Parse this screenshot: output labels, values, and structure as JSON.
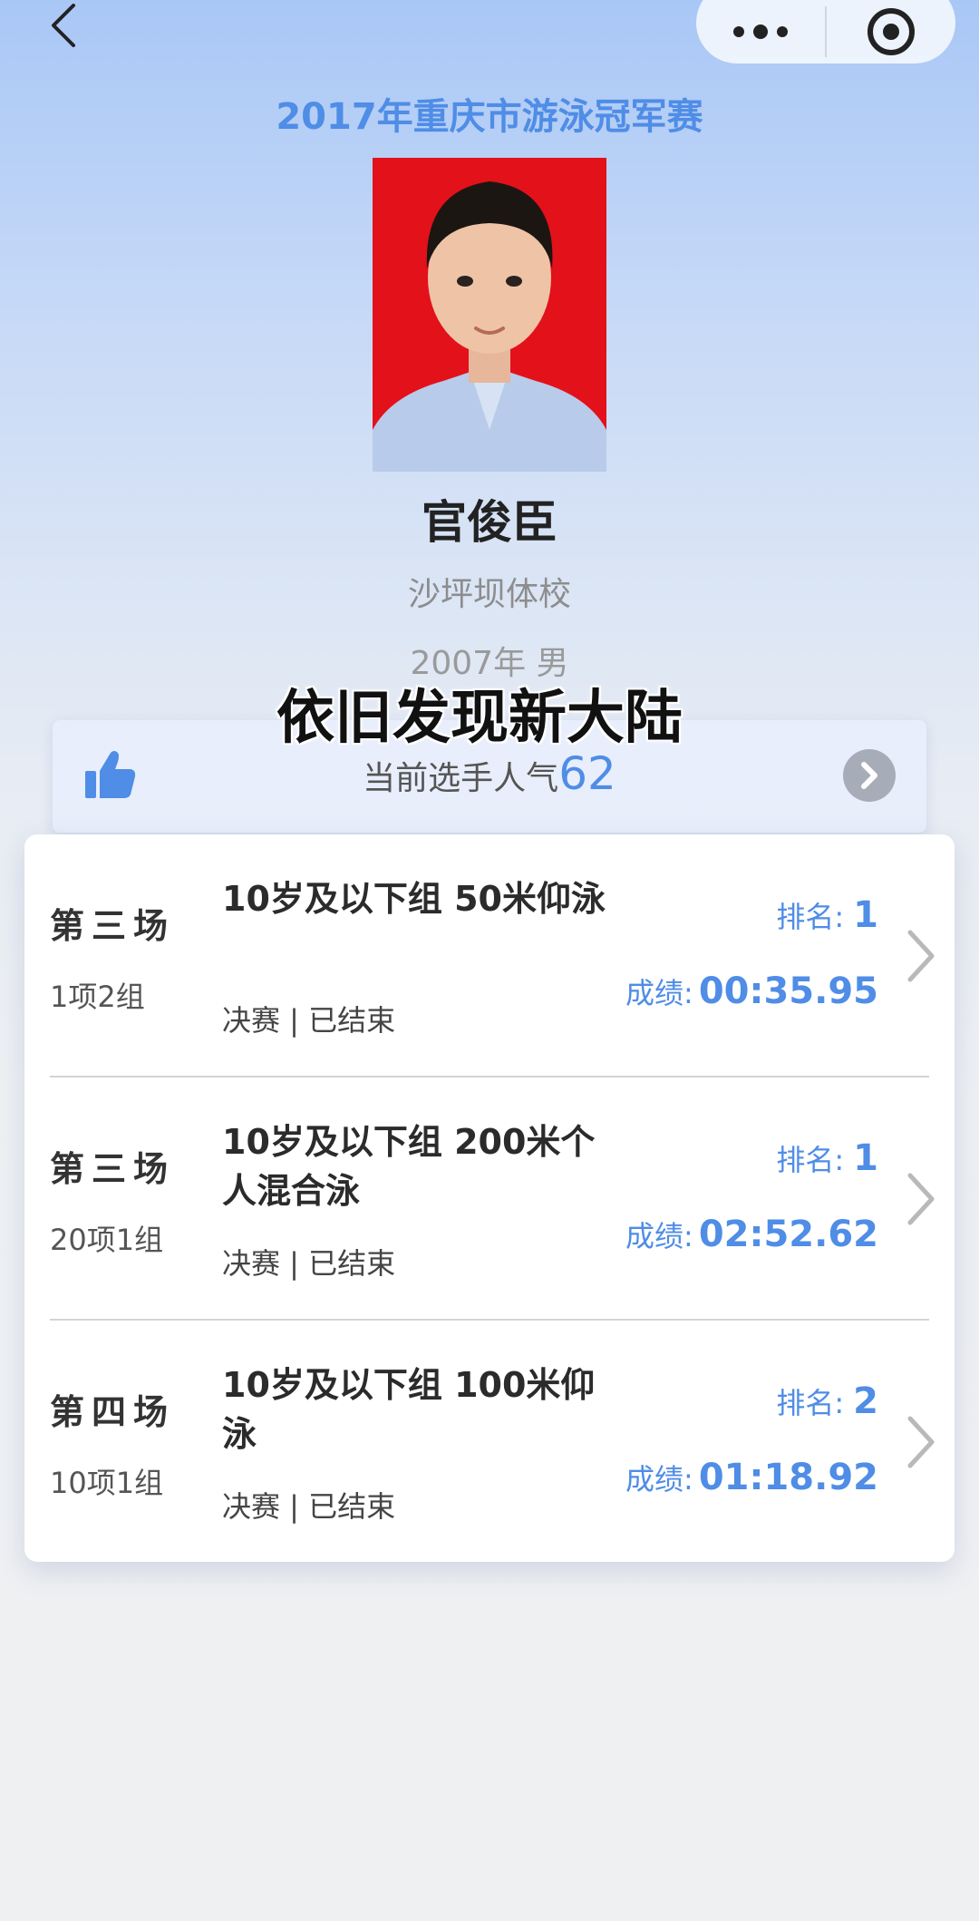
{
  "nav": {
    "back_icon": "chevron-left-icon",
    "more_icon": "more-dots-icon",
    "close_icon": "target-circle-icon"
  },
  "competition_title": "2017年重庆市游泳冠军赛",
  "athlete": {
    "name": "官俊臣",
    "school": "沙坪坝体校",
    "meta": "2007年 男",
    "photo_bg": "#e3111a"
  },
  "watermark": "依旧发现新大陆",
  "popularity": {
    "label": "当前选手人气",
    "value": "62",
    "icon": "thumbs-up-icon"
  },
  "results": [
    {
      "session": "第三场",
      "group": "1项2组",
      "event": "10岁及以下组 50米仰泳",
      "status": "决赛 | 已结束",
      "rank_label": "排名:",
      "rank": "1",
      "score_label": "成绩:",
      "score": "00:35.95"
    },
    {
      "session": "第三场",
      "group": "20项1组",
      "event": "10岁及以下组 200米个人混合泳",
      "status": "决赛 | 已结束",
      "rank_label": "排名:",
      "rank": "1",
      "score_label": "成绩:",
      "score": "02:52.62"
    },
    {
      "session": "第四场",
      "group": "10项1组",
      "event": "10岁及以下组 100米仰泳",
      "status": "决赛 | 已结束",
      "rank_label": "排名:",
      "rank": "2",
      "score_label": "成绩:",
      "score": "01:18.92"
    }
  ],
  "colors": {
    "accent": "#4f8de6",
    "header_bg": "#a9c7f6",
    "page_bg": "#eff0f2"
  }
}
